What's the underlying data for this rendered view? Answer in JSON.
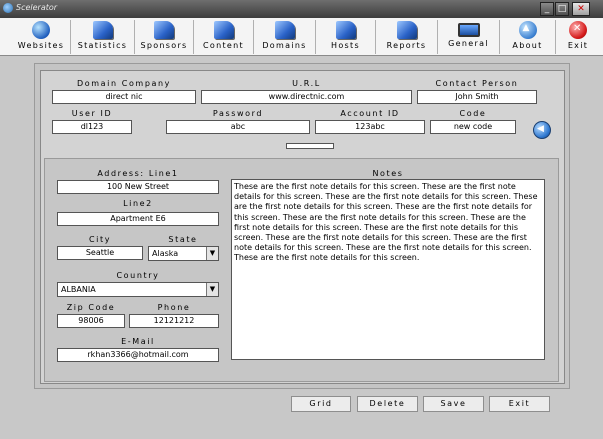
{
  "window": {
    "title": "Scelerator"
  },
  "toolbar": [
    {
      "label": "Websites",
      "icon": "globe-icon"
    },
    {
      "label": "Statistics",
      "icon": "statistics-icon"
    },
    {
      "label": "Sponsors",
      "icon": "sponsors-icon"
    },
    {
      "label": "Content",
      "icon": "content-icon"
    },
    {
      "label": "Domains",
      "icon": "domains-icon"
    },
    {
      "label": "Hosts",
      "icon": "hosts-icon"
    },
    {
      "label": "Reports",
      "icon": "reports-icon"
    },
    {
      "label": "General",
      "icon": "monitor-icon"
    },
    {
      "label": "About",
      "icon": "about-icon"
    },
    {
      "label": "Exit",
      "icon": "exit-icon"
    }
  ],
  "form": {
    "domain_company": {
      "label": "Domain Company",
      "value": "direct nic"
    },
    "url": {
      "label": "U.R.L",
      "value": "www.directnic.com"
    },
    "contact_person": {
      "label": "Contact Person",
      "value": "John Smith"
    },
    "user_id": {
      "label": "User ID",
      "value": "dl123"
    },
    "password": {
      "label": "Password",
      "value": "abc"
    },
    "account_id": {
      "label": "Account ID",
      "value": "123abc"
    },
    "code": {
      "label": "Code",
      "value": "new code"
    },
    "address_line1": {
      "label": "Address: Line1",
      "value": "100 New Street"
    },
    "address_line2": {
      "label": "Line2",
      "value": "Apartment E6"
    },
    "city": {
      "label": "City",
      "value": "Seattle"
    },
    "state": {
      "label": "State",
      "value": "Alaska"
    },
    "country": {
      "label": "Country",
      "value": "ALBANIA"
    },
    "zip_code": {
      "label": "Zip Code",
      "value": "98006"
    },
    "phone": {
      "label": "Phone",
      "value": "12121212"
    },
    "email": {
      "label": "E-Mail",
      "value": "rkhan3366@hotmail.com"
    },
    "notes": {
      "label": "Notes",
      "value": "These are the first note details for this screen. These are the first note details for this screen. These are the first note details for this screen. These are the first note details for this screen. These are the first note details for this screen. These are the first note details for this screen. These are the first note details for this screen. These are the first note details for this screen. These are the first note details for this screen. These are the first note details for this screen. These are the first note details for this screen. These are the first note details for this screen."
    }
  },
  "buttons": {
    "grid": "Grid",
    "delete": "Delete",
    "save": "Save",
    "exit": "Exit"
  }
}
